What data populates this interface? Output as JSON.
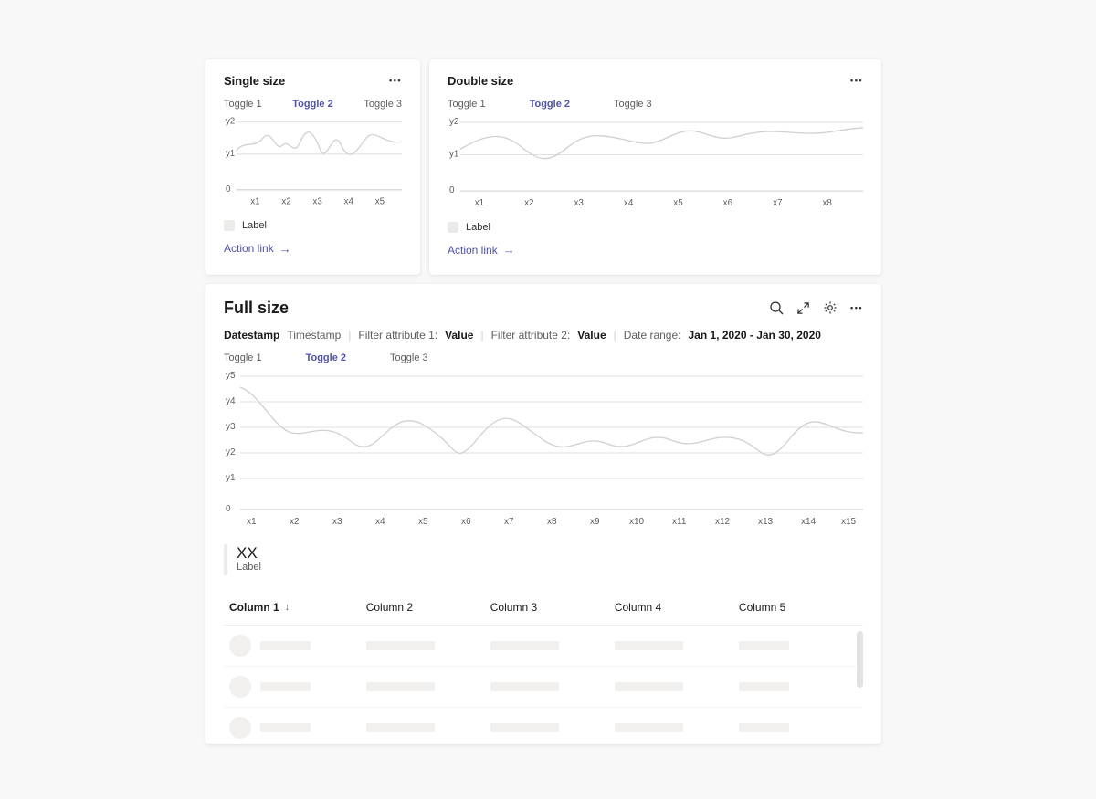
{
  "cards": {
    "single": {
      "title": "Single size",
      "toggles": [
        "Toggle 1",
        "Toggle 2",
        "Toggle 3"
      ],
      "active_toggle_index": 1,
      "legend_label": "Label",
      "action_link": "Action link",
      "chart": {
        "x_ticks": [
          "x1",
          "x2",
          "x3",
          "x4",
          "x5"
        ],
        "y_ticks": [
          "0",
          "y1",
          "y2"
        ]
      }
    },
    "double": {
      "title": "Double size",
      "toggles": [
        "Toggle 1",
        "Toggle 2",
        "Toggle 3"
      ],
      "active_toggle_index": 1,
      "legend_label": "Label",
      "action_link": "Action link",
      "chart": {
        "x_ticks": [
          "x1",
          "x2",
          "x3",
          "x4",
          "x5",
          "x6",
          "x7",
          "x8"
        ],
        "y_ticks": [
          "0",
          "y1",
          "y2"
        ]
      }
    },
    "full": {
      "title": "Full size",
      "toggles": [
        "Toggle 1",
        "Toggle 2",
        "Toggle 3"
      ],
      "active_toggle_index": 1,
      "filters": {
        "datestamp_label": "Datestamp",
        "timestamp_label": "Timestamp",
        "filter1_label": "Filter attribute 1:",
        "filter1_value": "Value",
        "filter2_label": "Filter attribute 2:",
        "filter2_value": "Value",
        "date_range_label": "Date range:",
        "date_range_value": "Jan 1, 2020 - Jan 30, 2020"
      },
      "chart": {
        "x_ticks": [
          "x1",
          "x2",
          "x3",
          "x4",
          "x5",
          "x6",
          "x7",
          "x8",
          "x9",
          "x10",
          "x11",
          "x12",
          "x13",
          "x14",
          "x15"
        ],
        "y_ticks": [
          "0",
          "y1",
          "y2",
          "y3",
          "y4",
          "y5"
        ]
      },
      "stat": {
        "value": "XX",
        "label": "Label"
      },
      "table": {
        "columns": [
          "Column 1",
          "Column 2",
          "Column 3",
          "Column 4",
          "Column 5"
        ],
        "sort_column_index": 0
      }
    }
  },
  "chart_data": [
    {
      "type": "line",
      "title": "Single size",
      "categories": [
        "x1",
        "x2",
        "x3",
        "x4",
        "x5"
      ],
      "y_ticks": [
        "0",
        "y1",
        "y2"
      ],
      "ylim": [
        0,
        2
      ],
      "series": [
        {
          "name": "Label",
          "values": [
            1.1,
            1.5,
            1.3,
            1.8,
            1.1,
            1.4,
            1.9,
            1.2,
            1.5
          ]
        }
      ]
    },
    {
      "type": "line",
      "title": "Double size",
      "categories": [
        "x1",
        "x2",
        "x3",
        "x4",
        "x5",
        "x6",
        "x7",
        "x8"
      ],
      "y_ticks": [
        "0",
        "y1",
        "y2"
      ],
      "ylim": [
        0,
        2
      ],
      "series": [
        {
          "name": "Label",
          "values": [
            1.2,
            1.6,
            1.2,
            0.9,
            1.4,
            1.6,
            1.4,
            1.6,
            1.5,
            1.7,
            1.55,
            1.7,
            1.6,
            1.75,
            1.7
          ]
        }
      ]
    },
    {
      "type": "line",
      "title": "Full size",
      "categories": [
        "x1",
        "x2",
        "x3",
        "x4",
        "x5",
        "x6",
        "x7",
        "x8",
        "x9",
        "x10",
        "x11",
        "x12",
        "x13",
        "x14",
        "x15"
      ],
      "y_ticks": [
        "0",
        "y1",
        "y2",
        "y3",
        "y4",
        "y5"
      ],
      "ylim": [
        0,
        5
      ],
      "series": [
        {
          "name": "Label",
          "values": [
            4.6,
            3.0,
            2.7,
            3.2,
            2.5,
            3.4,
            1.6,
            3.0,
            2.6,
            2.9,
            2.5,
            2.8,
            2.6,
            1.5,
            2.8,
            2.7
          ]
        }
      ]
    }
  ]
}
